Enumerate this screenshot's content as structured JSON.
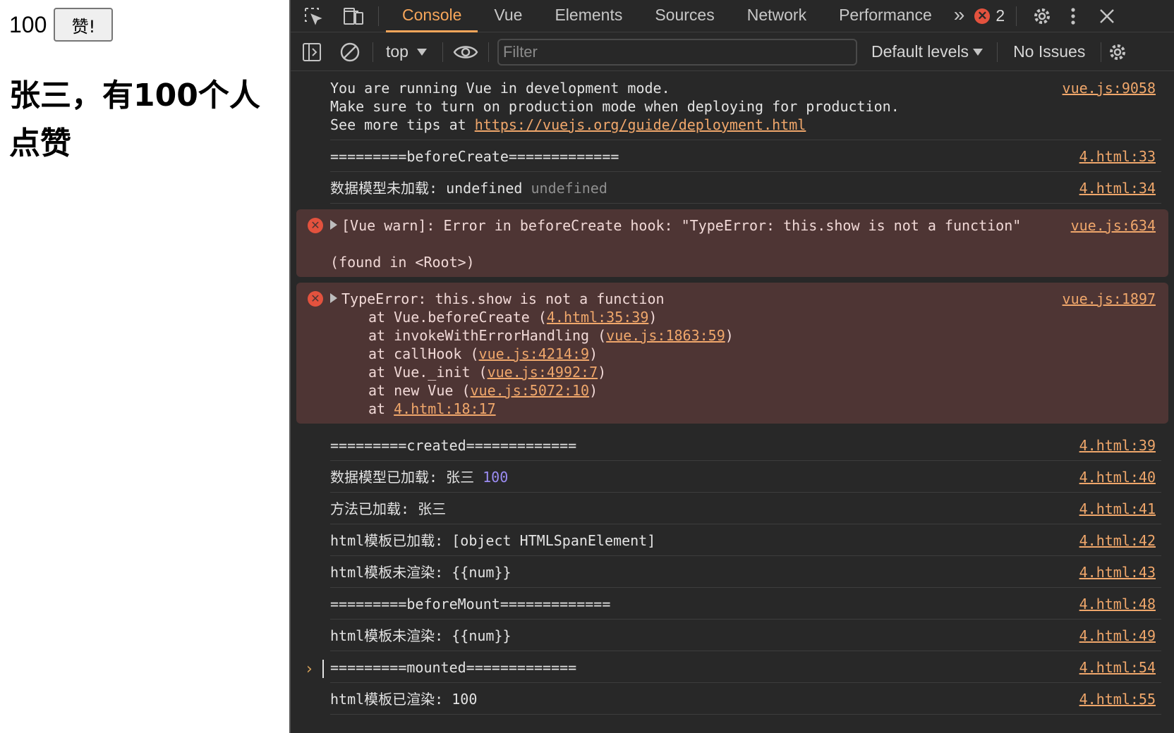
{
  "page": {
    "count": "100",
    "like_button": "赞!",
    "heading": "张三，有100个人点赞"
  },
  "devtools": {
    "tabs": [
      "Console",
      "Vue",
      "Elements",
      "Sources",
      "Network",
      "Performance"
    ],
    "active_tab": "Console",
    "more_tabs": "»",
    "error_count": "2",
    "toolbar": {
      "context": "top",
      "filter_placeholder": "Filter",
      "levels": "Default levels",
      "issues": "No Issues"
    },
    "colors": {
      "accent": "#f7a65a",
      "error": "#e3523e",
      "error_bg": "#4e3534",
      "link": "#f0a76b",
      "number": "#9b8cf2"
    }
  },
  "console": {
    "m0": {
      "line1": "You are running Vue in development mode.",
      "line2": "Make sure to turn on production mode when deploying for production.",
      "line3_prefix": "See more tips at ",
      "line3_link": "https://vuejs.org/guide/deployment.html",
      "src": "vue.js:9058"
    },
    "m1": {
      "text": "=========beforeCreate=============",
      "src": "4.html:33"
    },
    "m2": {
      "label": "数据模型未加载: ",
      "value": "undefined",
      "value2": "undefined",
      "src": "4.html:34"
    },
    "m3": {
      "text": "[Vue warn]: Error in beforeCreate hook: \"TypeError: this.show is not a function\"",
      "found": "(found in <Root>)",
      "src": "vue.js:634"
    },
    "m4": {
      "text": "TypeError: this.show is not a function",
      "src": "vue.js:1897",
      "stack": [
        {
          "prefix": "at Vue.beforeCreate (",
          "link": "4.html:35:39",
          "suffix": ")"
        },
        {
          "prefix": "at invokeWithErrorHandling (",
          "link": "vue.js:1863:59",
          "suffix": ")"
        },
        {
          "prefix": "at callHook (",
          "link": "vue.js:4214:9",
          "suffix": ")"
        },
        {
          "prefix": "at Vue._init (",
          "link": "vue.js:4992:7",
          "suffix": ")"
        },
        {
          "prefix": "at new Vue (",
          "link": "vue.js:5072:10",
          "suffix": ")"
        },
        {
          "prefix": "at ",
          "link": "4.html:18:17",
          "suffix": ""
        }
      ]
    },
    "m5": {
      "text": "=========created=============",
      "src": "4.html:39"
    },
    "m6": {
      "label": "数据模型已加载: 张三 ",
      "value": "100",
      "src": "4.html:40"
    },
    "m7": {
      "text": "方法已加载: 张三",
      "src": "4.html:41"
    },
    "m8": {
      "text": "html模板已加载: [object HTMLSpanElement]",
      "src": "4.html:42"
    },
    "m9": {
      "text": "html模板未渲染: {{num}}",
      "src": "4.html:43"
    },
    "m10": {
      "text": "=========beforeMount=============",
      "src": "4.html:48"
    },
    "m11": {
      "text": "html模板未渲染: {{num}}",
      "src": "4.html:49"
    },
    "m12": {
      "text": "=========mounted=============",
      "src": "4.html:54"
    },
    "m13": {
      "text": "html模板已渲染: 100",
      "src": "4.html:55"
    },
    "prompt": "›"
  }
}
